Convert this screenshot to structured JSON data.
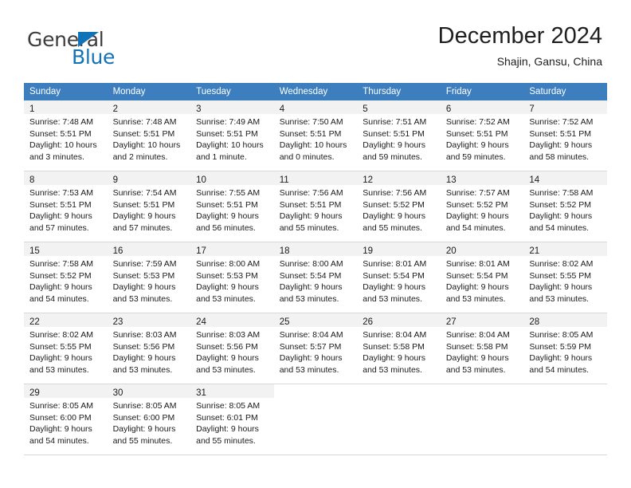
{
  "brand": {
    "name_part1": "General",
    "name_part2": "Blue",
    "triangle_color": "#1272b8"
  },
  "header": {
    "title": "December 2024",
    "subtitle": "Shajin, Gansu, China"
  },
  "colors": {
    "header_row": "#3d7ebf",
    "daynum_strip": "#f2f2f2",
    "grid_line": "#d8d8d8",
    "brand_blue": "#1272b8"
  },
  "weekday_headers": [
    "Sunday",
    "Monday",
    "Tuesday",
    "Wednesday",
    "Thursday",
    "Friday",
    "Saturday"
  ],
  "weeks": [
    [
      {
        "day": "1",
        "sunrise": "Sunrise: 7:48 AM",
        "sunset": "Sunset: 5:51 PM",
        "daylight1": "Daylight: 10 hours",
        "daylight2": "and 3 minutes."
      },
      {
        "day": "2",
        "sunrise": "Sunrise: 7:48 AM",
        "sunset": "Sunset: 5:51 PM",
        "daylight1": "Daylight: 10 hours",
        "daylight2": "and 2 minutes."
      },
      {
        "day": "3",
        "sunrise": "Sunrise: 7:49 AM",
        "sunset": "Sunset: 5:51 PM",
        "daylight1": "Daylight: 10 hours",
        "daylight2": "and 1 minute."
      },
      {
        "day": "4",
        "sunrise": "Sunrise: 7:50 AM",
        "sunset": "Sunset: 5:51 PM",
        "daylight1": "Daylight: 10 hours",
        "daylight2": "and 0 minutes."
      },
      {
        "day": "5",
        "sunrise": "Sunrise: 7:51 AM",
        "sunset": "Sunset: 5:51 PM",
        "daylight1": "Daylight: 9 hours",
        "daylight2": "and 59 minutes."
      },
      {
        "day": "6",
        "sunrise": "Sunrise: 7:52 AM",
        "sunset": "Sunset: 5:51 PM",
        "daylight1": "Daylight: 9 hours",
        "daylight2": "and 59 minutes."
      },
      {
        "day": "7",
        "sunrise": "Sunrise: 7:52 AM",
        "sunset": "Sunset: 5:51 PM",
        "daylight1": "Daylight: 9 hours",
        "daylight2": "and 58 minutes."
      }
    ],
    [
      {
        "day": "8",
        "sunrise": "Sunrise: 7:53 AM",
        "sunset": "Sunset: 5:51 PM",
        "daylight1": "Daylight: 9 hours",
        "daylight2": "and 57 minutes."
      },
      {
        "day": "9",
        "sunrise": "Sunrise: 7:54 AM",
        "sunset": "Sunset: 5:51 PM",
        "daylight1": "Daylight: 9 hours",
        "daylight2": "and 57 minutes."
      },
      {
        "day": "10",
        "sunrise": "Sunrise: 7:55 AM",
        "sunset": "Sunset: 5:51 PM",
        "daylight1": "Daylight: 9 hours",
        "daylight2": "and 56 minutes."
      },
      {
        "day": "11",
        "sunrise": "Sunrise: 7:56 AM",
        "sunset": "Sunset: 5:51 PM",
        "daylight1": "Daylight: 9 hours",
        "daylight2": "and 55 minutes."
      },
      {
        "day": "12",
        "sunrise": "Sunrise: 7:56 AM",
        "sunset": "Sunset: 5:52 PM",
        "daylight1": "Daylight: 9 hours",
        "daylight2": "and 55 minutes."
      },
      {
        "day": "13",
        "sunrise": "Sunrise: 7:57 AM",
        "sunset": "Sunset: 5:52 PM",
        "daylight1": "Daylight: 9 hours",
        "daylight2": "and 54 minutes."
      },
      {
        "day": "14",
        "sunrise": "Sunrise: 7:58 AM",
        "sunset": "Sunset: 5:52 PM",
        "daylight1": "Daylight: 9 hours",
        "daylight2": "and 54 minutes."
      }
    ],
    [
      {
        "day": "15",
        "sunrise": "Sunrise: 7:58 AM",
        "sunset": "Sunset: 5:52 PM",
        "daylight1": "Daylight: 9 hours",
        "daylight2": "and 54 minutes."
      },
      {
        "day": "16",
        "sunrise": "Sunrise: 7:59 AM",
        "sunset": "Sunset: 5:53 PM",
        "daylight1": "Daylight: 9 hours",
        "daylight2": "and 53 minutes."
      },
      {
        "day": "17",
        "sunrise": "Sunrise: 8:00 AM",
        "sunset": "Sunset: 5:53 PM",
        "daylight1": "Daylight: 9 hours",
        "daylight2": "and 53 minutes."
      },
      {
        "day": "18",
        "sunrise": "Sunrise: 8:00 AM",
        "sunset": "Sunset: 5:54 PM",
        "daylight1": "Daylight: 9 hours",
        "daylight2": "and 53 minutes."
      },
      {
        "day": "19",
        "sunrise": "Sunrise: 8:01 AM",
        "sunset": "Sunset: 5:54 PM",
        "daylight1": "Daylight: 9 hours",
        "daylight2": "and 53 minutes."
      },
      {
        "day": "20",
        "sunrise": "Sunrise: 8:01 AM",
        "sunset": "Sunset: 5:54 PM",
        "daylight1": "Daylight: 9 hours",
        "daylight2": "and 53 minutes."
      },
      {
        "day": "21",
        "sunrise": "Sunrise: 8:02 AM",
        "sunset": "Sunset: 5:55 PM",
        "daylight1": "Daylight: 9 hours",
        "daylight2": "and 53 minutes."
      }
    ],
    [
      {
        "day": "22",
        "sunrise": "Sunrise: 8:02 AM",
        "sunset": "Sunset: 5:55 PM",
        "daylight1": "Daylight: 9 hours",
        "daylight2": "and 53 minutes."
      },
      {
        "day": "23",
        "sunrise": "Sunrise: 8:03 AM",
        "sunset": "Sunset: 5:56 PM",
        "daylight1": "Daylight: 9 hours",
        "daylight2": "and 53 minutes."
      },
      {
        "day": "24",
        "sunrise": "Sunrise: 8:03 AM",
        "sunset": "Sunset: 5:56 PM",
        "daylight1": "Daylight: 9 hours",
        "daylight2": "and 53 minutes."
      },
      {
        "day": "25",
        "sunrise": "Sunrise: 8:04 AM",
        "sunset": "Sunset: 5:57 PM",
        "daylight1": "Daylight: 9 hours",
        "daylight2": "and 53 minutes."
      },
      {
        "day": "26",
        "sunrise": "Sunrise: 8:04 AM",
        "sunset": "Sunset: 5:58 PM",
        "daylight1": "Daylight: 9 hours",
        "daylight2": "and 53 minutes."
      },
      {
        "day": "27",
        "sunrise": "Sunrise: 8:04 AM",
        "sunset": "Sunset: 5:58 PM",
        "daylight1": "Daylight: 9 hours",
        "daylight2": "and 53 minutes."
      },
      {
        "day": "28",
        "sunrise": "Sunrise: 8:05 AM",
        "sunset": "Sunset: 5:59 PM",
        "daylight1": "Daylight: 9 hours",
        "daylight2": "and 54 minutes."
      }
    ],
    [
      {
        "day": "29",
        "sunrise": "Sunrise: 8:05 AM",
        "sunset": "Sunset: 6:00 PM",
        "daylight1": "Daylight: 9 hours",
        "daylight2": "and 54 minutes."
      },
      {
        "day": "30",
        "sunrise": "Sunrise: 8:05 AM",
        "sunset": "Sunset: 6:00 PM",
        "daylight1": "Daylight: 9 hours",
        "daylight2": "and 55 minutes."
      },
      {
        "day": "31",
        "sunrise": "Sunrise: 8:05 AM",
        "sunset": "Sunset: 6:01 PM",
        "daylight1": "Daylight: 9 hours",
        "daylight2": "and 55 minutes."
      },
      {
        "day": "",
        "sunrise": "",
        "sunset": "",
        "daylight1": "",
        "daylight2": ""
      },
      {
        "day": "",
        "sunrise": "",
        "sunset": "",
        "daylight1": "",
        "daylight2": ""
      },
      {
        "day": "",
        "sunrise": "",
        "sunset": "",
        "daylight1": "",
        "daylight2": ""
      },
      {
        "day": "",
        "sunrise": "",
        "sunset": "",
        "daylight1": "",
        "daylight2": ""
      }
    ]
  ]
}
